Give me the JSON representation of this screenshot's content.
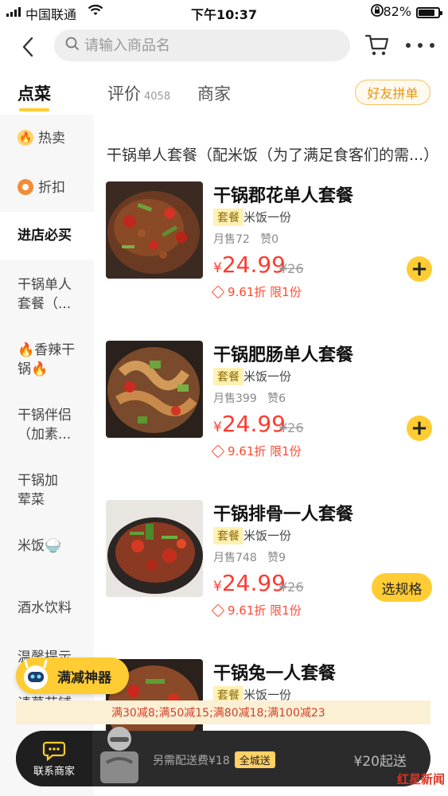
{
  "status_bar": {
    "carrier": "中国联通",
    "time": "下午10:37",
    "battery": "82%"
  },
  "search": {
    "placeholder": "请输入商品名"
  },
  "tabs": [
    {
      "label": "点菜",
      "active": true
    },
    {
      "label": "评价",
      "count": "4058"
    },
    {
      "label": "商家"
    }
  ],
  "pin_button": "好友拼单",
  "sidebar": {
    "items": [
      {
        "label": "热卖",
        "icon": "flame-icon"
      },
      {
        "label": "折扣",
        "icon": "discount-tag-icon"
      },
      {
        "label": "进店必买",
        "active": true
      },
      {
        "label": "干锅单人套餐（..."
      },
      {
        "label": "🔥香辣干锅🔥"
      },
      {
        "label": "干锅伴侣（加素..."
      },
      {
        "label": "干锅加荤菜"
      },
      {
        "label": "米饭🍚"
      },
      {
        "label": "酒水饮料"
      },
      {
        "label": "温馨提示"
      },
      {
        "label": "请草苗铺"
      }
    ]
  },
  "section_title": "干锅单人套餐（配米饭（为了满足食客们的需...）",
  "products": [
    {
      "name": "干锅郡花单人套餐",
      "tag": "套餐",
      "desc": "米饭一份",
      "sales": "月售72",
      "likes": "赞0",
      "yen": "¥",
      "price": "24.99",
      "original": "¥26",
      "discount": "9.61折 限1份",
      "action": "add"
    },
    {
      "name": "干锅肥肠单人套餐",
      "tag": "套餐",
      "desc": "米饭一份",
      "sales": "月售399",
      "likes": "赞6",
      "yen": "¥",
      "price": "24.99",
      "original": "¥26",
      "discount": "9.61折 限1份",
      "action": "add"
    },
    {
      "name": "干锅排骨一人套餐",
      "tag": "套餐",
      "desc": "米饭一份",
      "sales": "月售748",
      "likes": "赞9",
      "yen": "¥",
      "price": "24.99",
      "original": "¥26",
      "discount": "9.61折 限1份",
      "action": "spec",
      "action_label": "选规格"
    },
    {
      "name": "干锅兔一人套餐",
      "tag": "套餐",
      "desc": "米饭一份"
    }
  ],
  "add_symbol": "+",
  "promo_float": "满减神器",
  "promo_strip": "满30减8;满50减15;满80减18;满100减23",
  "bottom_bar": {
    "contact_label": "联系商家",
    "delivery_text": "另需配送费¥18",
    "city_tag": "全城送",
    "min_order": "¥20起送"
  },
  "watermark": "红星新闻",
  "colors": {
    "accent": "#ffcc33",
    "price": "#ff3b30",
    "bar": "#2b2b2b"
  }
}
